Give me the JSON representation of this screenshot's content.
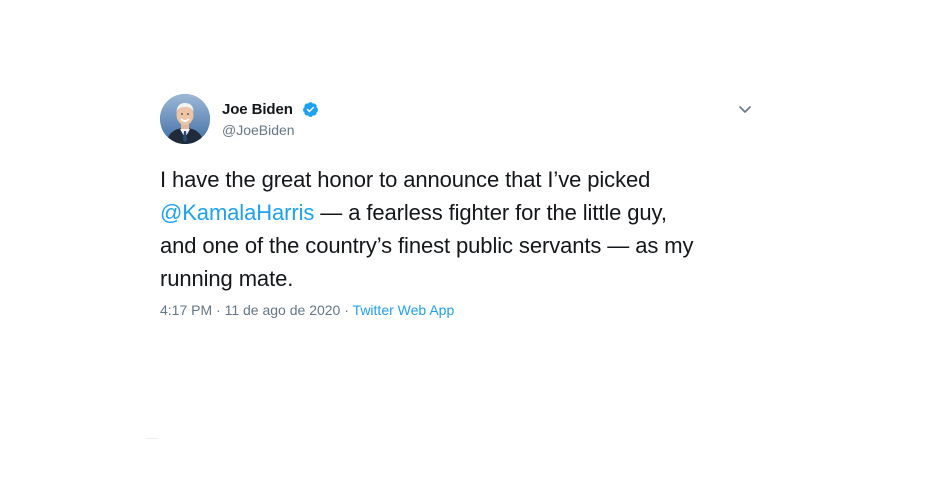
{
  "tweet": {
    "author_name": "Joe Biden",
    "handle": "@JoeBiden",
    "verified": true,
    "text_before": "I have the great honor to announce that I’ve picked\n",
    "mention": "@KamalaHarris",
    "text_after": " — a fearless fighter for the little guy,\nand one of the country’s finest public servants — as my\nrunning mate.",
    "time": "4:17 PM",
    "date": "11 de ago de 2020",
    "separator": " · ",
    "source": "Twitter Web App"
  },
  "colors": {
    "link": "#1da1f2",
    "secondary_text": "#657786",
    "primary_text": "#14171a",
    "verified": "#1da1f2"
  },
  "icons": {
    "verified": "verified-badge-icon",
    "menu": "chevron-down-icon",
    "avatar": "avatar"
  }
}
